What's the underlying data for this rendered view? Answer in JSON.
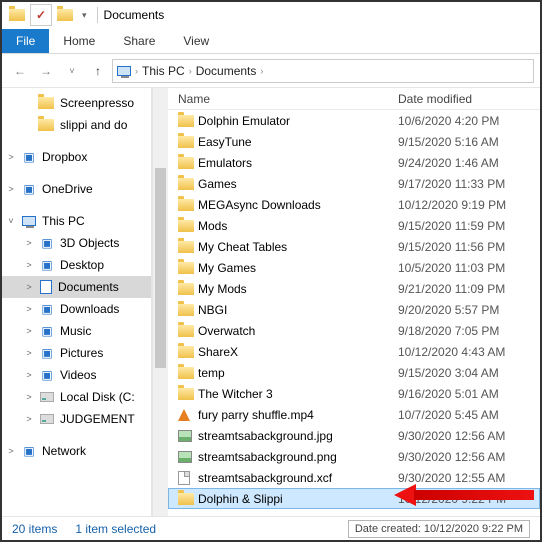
{
  "window": {
    "title": "Documents"
  },
  "ribbon": {
    "file": "File",
    "tabs": [
      "Home",
      "Share",
      "View"
    ]
  },
  "breadcrumb": [
    "This PC",
    "Documents"
  ],
  "columns": {
    "name": "Name",
    "modified": "Date modified"
  },
  "nav": {
    "quick": [
      {
        "label": "Screenpresso",
        "icon": "folder"
      },
      {
        "label": "slippi and do",
        "icon": "folder"
      }
    ],
    "dropbox": "Dropbox",
    "onedrive": "OneDrive",
    "thispc": "This PC",
    "pc_children": [
      {
        "label": "3D Objects",
        "icon": "generic"
      },
      {
        "label": "Desktop",
        "icon": "generic"
      },
      {
        "label": "Documents",
        "icon": "doc",
        "selected": true
      },
      {
        "label": "Downloads",
        "icon": "generic"
      },
      {
        "label": "Music",
        "icon": "generic"
      },
      {
        "label": "Pictures",
        "icon": "generic"
      },
      {
        "label": "Videos",
        "icon": "generic"
      },
      {
        "label": "Local Disk (C:",
        "icon": "drive"
      },
      {
        "label": "JUDGEMENT",
        "icon": "drive"
      }
    ],
    "network": "Network"
  },
  "files": [
    {
      "name": "Dolphin Emulator",
      "date": "10/6/2020 4:20 PM",
      "type": "folder"
    },
    {
      "name": "EasyTune",
      "date": "9/15/2020 5:16 AM",
      "type": "folder"
    },
    {
      "name": "Emulators",
      "date": "9/24/2020 1:46 AM",
      "type": "folder"
    },
    {
      "name": "Games",
      "date": "9/17/2020 11:33 PM",
      "type": "folder"
    },
    {
      "name": "MEGAsync Downloads",
      "date": "10/12/2020 9:19 PM",
      "type": "folder"
    },
    {
      "name": "Mods",
      "date": "9/15/2020 11:59 PM",
      "type": "folder"
    },
    {
      "name": "My Cheat Tables",
      "date": "9/15/2020 11:56 PM",
      "type": "folder"
    },
    {
      "name": "My Games",
      "date": "10/5/2020 11:03 PM",
      "type": "folder"
    },
    {
      "name": "My Mods",
      "date": "9/21/2020 11:09 PM",
      "type": "folder"
    },
    {
      "name": "NBGI",
      "date": "9/20/2020 5:57 PM",
      "type": "folder"
    },
    {
      "name": "Overwatch",
      "date": "9/18/2020 7:05 PM",
      "type": "folder"
    },
    {
      "name": "ShareX",
      "date": "10/12/2020 4:43 AM",
      "type": "folder"
    },
    {
      "name": "temp",
      "date": "9/15/2020 3:04 AM",
      "type": "folder"
    },
    {
      "name": "The Witcher 3",
      "date": "9/16/2020 5:01 AM",
      "type": "folder"
    },
    {
      "name": "fury parry shuffle.mp4",
      "date": "10/7/2020 5:45 AM",
      "type": "video"
    },
    {
      "name": "streamtsabackground.jpg",
      "date": "9/30/2020 12:56 AM",
      "type": "image"
    },
    {
      "name": "streamtsabackground.png",
      "date": "9/30/2020 12:56 AM",
      "type": "image"
    },
    {
      "name": "streamtsabackground.xcf",
      "date": "9/30/2020 12:55 AM",
      "type": "file"
    },
    {
      "name": "Dolphin & Slippi",
      "date": "10/12/2020 9:22 PM",
      "type": "folder",
      "selected": true
    }
  ],
  "status": {
    "count": "20 items",
    "selected": "1 item selected"
  },
  "tooltip": "Date created: 10/12/2020 9:22 PM"
}
